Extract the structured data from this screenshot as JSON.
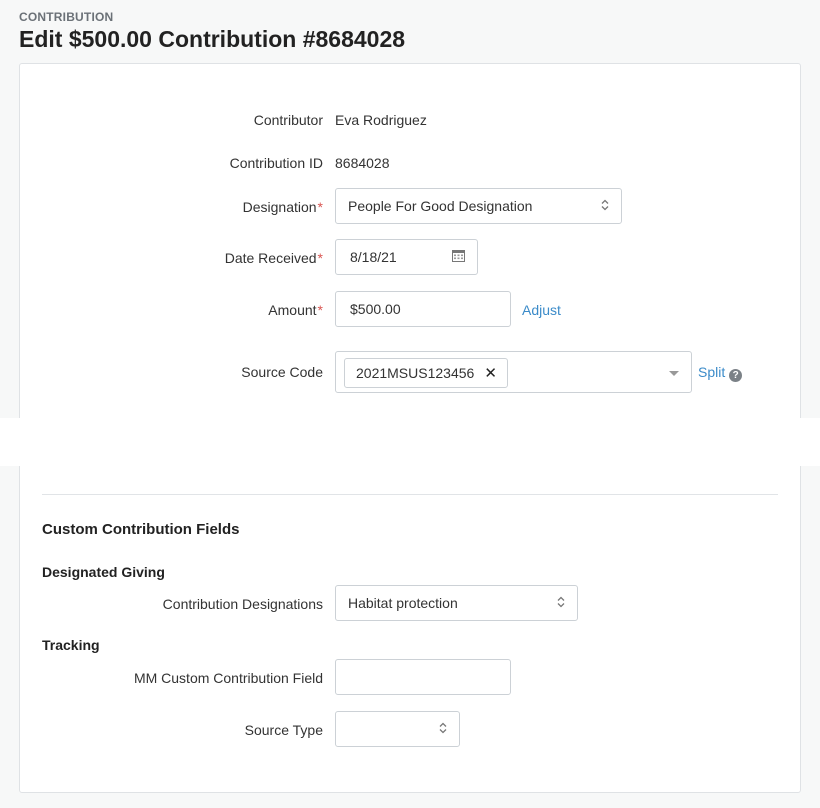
{
  "header": {
    "eyebrow": "CONTRIBUTION",
    "title": "Edit $500.00 Contribution #8684028"
  },
  "form": {
    "contributor": {
      "label": "Contributor",
      "value": "Eva Rodriguez"
    },
    "contribution_id": {
      "label": "Contribution ID",
      "value": "8684028"
    },
    "designation": {
      "label": "Designation",
      "required_mark": "*",
      "value": "People For Good Designation"
    },
    "date_received": {
      "label": "Date Received",
      "required_mark": "*",
      "value": "8/18/21"
    },
    "amount": {
      "label": "Amount",
      "required_mark": "*",
      "value": "$500.00",
      "adjust_link": "Adjust"
    },
    "source_code": {
      "label": "Source Code",
      "tag": "2021MSUS123456",
      "split_link": "Split"
    }
  },
  "custom": {
    "section_title": "Custom Contribution Fields",
    "designated_giving": {
      "title": "Designated Giving",
      "contribution_designations": {
        "label": "Contribution Designations",
        "value": "Habitat protection"
      }
    },
    "tracking": {
      "title": "Tracking",
      "mm_field": {
        "label": "MM Custom Contribution Field",
        "value": ""
      },
      "source_type": {
        "label": "Source Type",
        "value": ""
      }
    }
  },
  "icons": {
    "calendar": "calendar-icon",
    "remove": "close-icon",
    "help": "question-circle-icon",
    "select": "chevron-up-down-icon",
    "dropdown": "caret-down-icon"
  },
  "colors": {
    "link": "#3b8bc9",
    "required": "#d9534f"
  }
}
